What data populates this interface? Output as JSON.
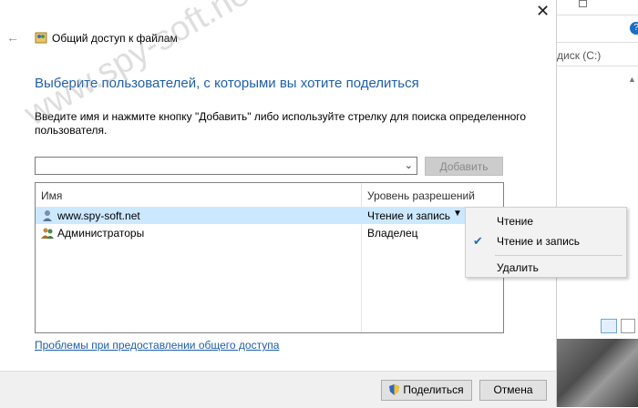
{
  "window": {
    "title": "Общий доступ к файлам",
    "close_glyph": "✕",
    "back_glyph": "←"
  },
  "heading": "Выберите пользователей, с которыми вы хотите поделиться",
  "instruction": "Введите имя и нажмите кнопку \"Добавить\" либо используйте стрелку для поиска определенного пользователя.",
  "combo": {
    "value": "",
    "arrow_glyph": "⌄"
  },
  "add_button": "Добавить",
  "table": {
    "columns": [
      "Имя",
      "Уровень разрешений"
    ],
    "rows": [
      {
        "name": "www.spy-soft.net",
        "permission": "Чтение и запись",
        "selected": true,
        "icon": "user-icon"
      },
      {
        "name": "Администраторы",
        "permission": "Владелец",
        "selected": false,
        "icon": "group-icon"
      }
    ]
  },
  "permission_menu": {
    "items": [
      {
        "label": "Чтение",
        "checked": false
      },
      {
        "label": "Чтение и запись",
        "checked": true
      },
      {
        "label": "Удалить",
        "checked": false
      }
    ],
    "check_glyph": "✔"
  },
  "help_link": "Проблемы при предоставлении общего доступа",
  "share_button": "Поделиться",
  "cancel_button": "Отмена",
  "background": {
    "drive_label": "диск (C:)",
    "help_glyph": "?"
  },
  "watermark": "www.spy-soft.net",
  "colors": {
    "accent": "#1f5fa8",
    "selection": "#cce8ff",
    "menu_background": "#f2f2f2",
    "footer": "#f0f0f0"
  }
}
